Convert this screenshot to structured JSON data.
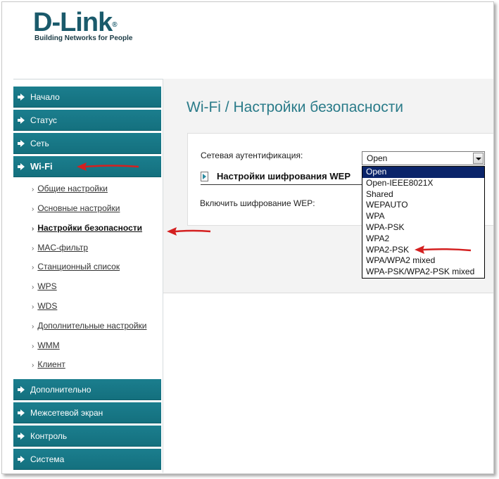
{
  "brand": {
    "logo": "D-Link",
    "tagline": "Building Networks for People"
  },
  "sidebar": {
    "top_items": [
      {
        "label": "Начало"
      },
      {
        "label": "Статус"
      },
      {
        "label": "Сеть"
      },
      {
        "label": "Wi-Fi"
      }
    ],
    "wifi_subitems": [
      {
        "label": "Общие настройки"
      },
      {
        "label": "Основные настройки"
      },
      {
        "label": "Настройки безопасности"
      },
      {
        "label": "MAC-фильтр"
      },
      {
        "label": "Станционный список"
      },
      {
        "label": "WPS"
      },
      {
        "label": "WDS"
      },
      {
        "label": "Дополнительные настройки"
      },
      {
        "label": "WMM"
      },
      {
        "label": "Клиент"
      }
    ],
    "bottom_items": [
      {
        "label": "Дополнительно"
      },
      {
        "label": "Межсетевой экран"
      },
      {
        "label": "Контроль"
      },
      {
        "label": "Система"
      }
    ]
  },
  "page": {
    "title": "Wi-Fi  /  Настройки безопасности",
    "auth_label": "Сетевая аутентификация:",
    "wep_section_title": "Настройки шифрования WEP",
    "wep_enable_label": "Включить шифрование WEP:"
  },
  "auth_select": {
    "value": "Open",
    "options": [
      "Open",
      "Open-IEEE8021X",
      "Shared",
      "WEPAUTO",
      "WPA",
      "WPA-PSK",
      "WPA2",
      "WPA2-PSK",
      "WPA/WPA2 mixed",
      "WPA-PSK/WPA2-PSK mixed"
    ]
  },
  "colors": {
    "nav_bg": "#16788a",
    "title": "#2a7b89",
    "annotation_arrow": "#d42020",
    "selected_option": "#0a246a"
  }
}
